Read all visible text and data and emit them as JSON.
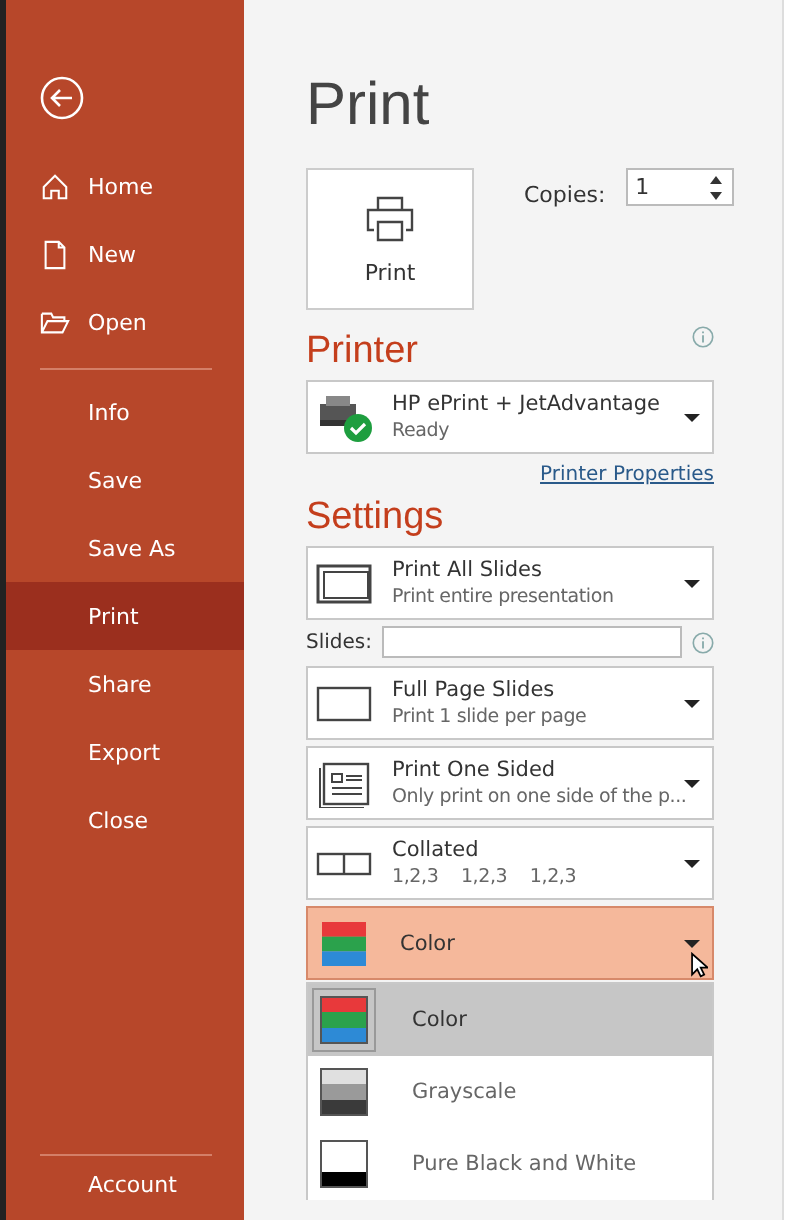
{
  "sidebar": {
    "top_items": [
      {
        "label": "Home",
        "selected": false
      },
      {
        "label": "New",
        "selected": false
      },
      {
        "label": "Open",
        "selected": false
      }
    ],
    "items": [
      {
        "label": "Info",
        "selected": false
      },
      {
        "label": "Save",
        "selected": false
      },
      {
        "label": "Save As",
        "selected": false
      },
      {
        "label": "Print",
        "selected": true
      },
      {
        "label": "Share",
        "selected": false
      },
      {
        "label": "Export",
        "selected": false
      },
      {
        "label": "Close",
        "selected": false
      }
    ],
    "bottom_items": [
      {
        "label": "Account",
        "selected": false
      }
    ]
  },
  "title": "Print",
  "print_button": "Print",
  "copies": {
    "label": "Copies:",
    "value": "1"
  },
  "printer": {
    "heading": "Printer",
    "name": "HP ePrint + JetAdvantage",
    "status": "Ready",
    "link": "Printer Properties"
  },
  "settings": {
    "heading": "Settings",
    "slides_label": "Slides:",
    "dropdowns": [
      {
        "kind": "slides",
        "title": "Print All Slides",
        "subtitle": "Print entire presentation"
      },
      {
        "kind": "layout",
        "title": "Full Page Slides",
        "subtitle": "Print 1 slide per page"
      },
      {
        "kind": "sides",
        "title": "Print One Sided",
        "subtitle": "Only print on one side of the p..."
      },
      {
        "kind": "collate",
        "title": "Collated",
        "subtitle": "1,2,3    1,2,3    1,2,3"
      }
    ],
    "color_dropdown": {
      "kind": "color",
      "title": "Color",
      "expanded": true
    },
    "color_options": [
      {
        "kind": "color",
        "label": "Color",
        "selected": true
      },
      {
        "kind": "grayscale",
        "label": "Grayscale",
        "selected": false
      },
      {
        "kind": "bw",
        "label": "Pure Black and White",
        "selected": false
      }
    ]
  }
}
